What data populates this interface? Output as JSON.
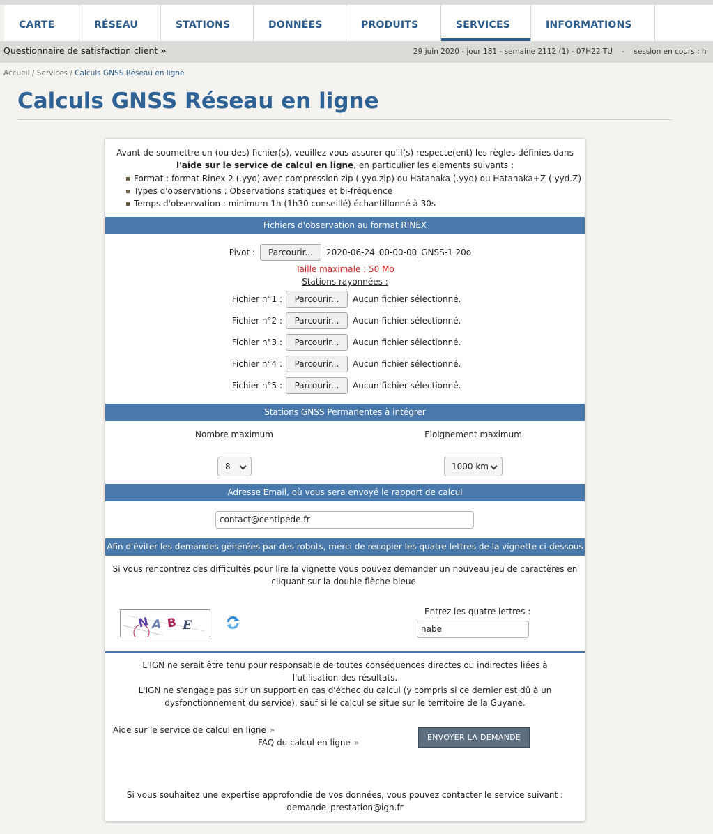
{
  "nav": {
    "items": [
      {
        "label": "CARTE",
        "active": false
      },
      {
        "label": "RÉSEAU",
        "active": false
      },
      {
        "label": "STATIONS",
        "active": false
      },
      {
        "label": "DONNÉES",
        "active": false
      },
      {
        "label": "PRODUITS",
        "active": false
      },
      {
        "label": "SERVICES",
        "active": true
      },
      {
        "label": "INFORMATIONS",
        "active": false
      }
    ]
  },
  "subbar": {
    "survey_label": "Questionnaire de satisfaction client",
    "survey_chevron": "»",
    "date_info": "29 juin 2020 - jour 181 - semaine 2112 (1) - 07H22 TU    -    session en cours : h"
  },
  "breadcrumb": {
    "home": "Accueil",
    "sep": " / ",
    "services": "Services",
    "current": "Calculs GNSS Réseau en ligne"
  },
  "page_title": "Calculs GNSS Réseau en ligne",
  "intro": {
    "text_before": "Avant de soumettre un (ou des) fichier(s), veuillez vous assurer qu'il(s) respecte(ent) les règles définies dans ",
    "bold_link": "l'aide sur le service de calcul en ligne",
    "text_after": ", en particulier les elements suivants :",
    "rules": [
      "Format : format Rinex 2 (.yyo) avec compression zip (.yyo.zip) ou Hatanaka (.yyd) ou Hatanaka+Z (.yyd.Z)",
      "Types d'observations : Observations statiques et bi-fréquence",
      "Temps d'observation : minimum 1h (1h30 conseillé) échantillonné à 30s"
    ]
  },
  "sections": {
    "rinex": "Fichiers d'observation au format RINEX",
    "permanent": "Stations GNSS Permanentes à intégrer",
    "email": "Adresse Email, où vous sera envoyé le rapport de calcul",
    "captcha": "Afin d'éviter les demandes générées par des robots, merci de recopier les quatre lettres de la vignette ci-dessous"
  },
  "pivot": {
    "label": "Pivot :",
    "button": "Parcourir...",
    "file": "2020-06-24_00-00-00_GNSS-1.20o"
  },
  "max_size": "Taille maximale : 50 Mo",
  "rayonnees_label": "Stations rayonnées :",
  "files": [
    {
      "label": "Fichier n°1 :",
      "button": "Parcourir...",
      "status": "Aucun fichier sélectionné."
    },
    {
      "label": "Fichier n°2 :",
      "button": "Parcourir...",
      "status": "Aucun fichier sélectionné."
    },
    {
      "label": "Fichier n°3 :",
      "button": "Parcourir...",
      "status": "Aucun fichier sélectionné."
    },
    {
      "label": "Fichier n°4 :",
      "button": "Parcourir...",
      "status": "Aucun fichier sélectionné."
    },
    {
      "label": "Fichier n°5 :",
      "button": "Parcourir...",
      "status": "Aucun fichier sélectionné."
    }
  ],
  "permanent": {
    "max_number_label": "Nombre maximum",
    "max_number_value": "8",
    "max_distance_label": "Eloignement maximum",
    "max_distance_value": "1000 km"
  },
  "email": {
    "value": "contact@centipede.fr"
  },
  "captcha": {
    "help": "Si vous rencontrez des difficultés pour lire la vignette vous pouvez demander un nouveau jeu de caractères en cliquant sur la double flèche bleue.",
    "image_letters": [
      "N",
      "A",
      "B",
      "E"
    ],
    "input_label": "Entrez les quatre lettres :",
    "input_value": "nabe"
  },
  "disclaimer": {
    "line1": "L'IGN ne serait être tenu pour responsable de toutes conséquences directes ou indirectes liées à l'utilisation des résultats.",
    "line2": "L'IGN ne s'engage pas sur un support en cas d'échec du calcul (y compris si ce dernier est dû à un dysfonctionnement du service), sauf si le calcul se situe sur le territoire de la Guyane."
  },
  "links": {
    "aide": "Aide sur le service de calcul en ligne",
    "faq": "FAQ du calcul en ligne",
    "chevron": "»"
  },
  "send_button": "ENVOYER LA DEMANDE",
  "expertise": {
    "text": "Si vous souhaitez une expertise approfondie de vos données, vous pouvez contacter le service suivant :",
    "email": "demande_prestation@ign.fr"
  },
  "colors": {
    "nav_text": "#2a5a8a",
    "section_header": "#4a7aad",
    "title": "#2e6294",
    "warning": "#cc2222",
    "send_button": "#5d6f80"
  }
}
